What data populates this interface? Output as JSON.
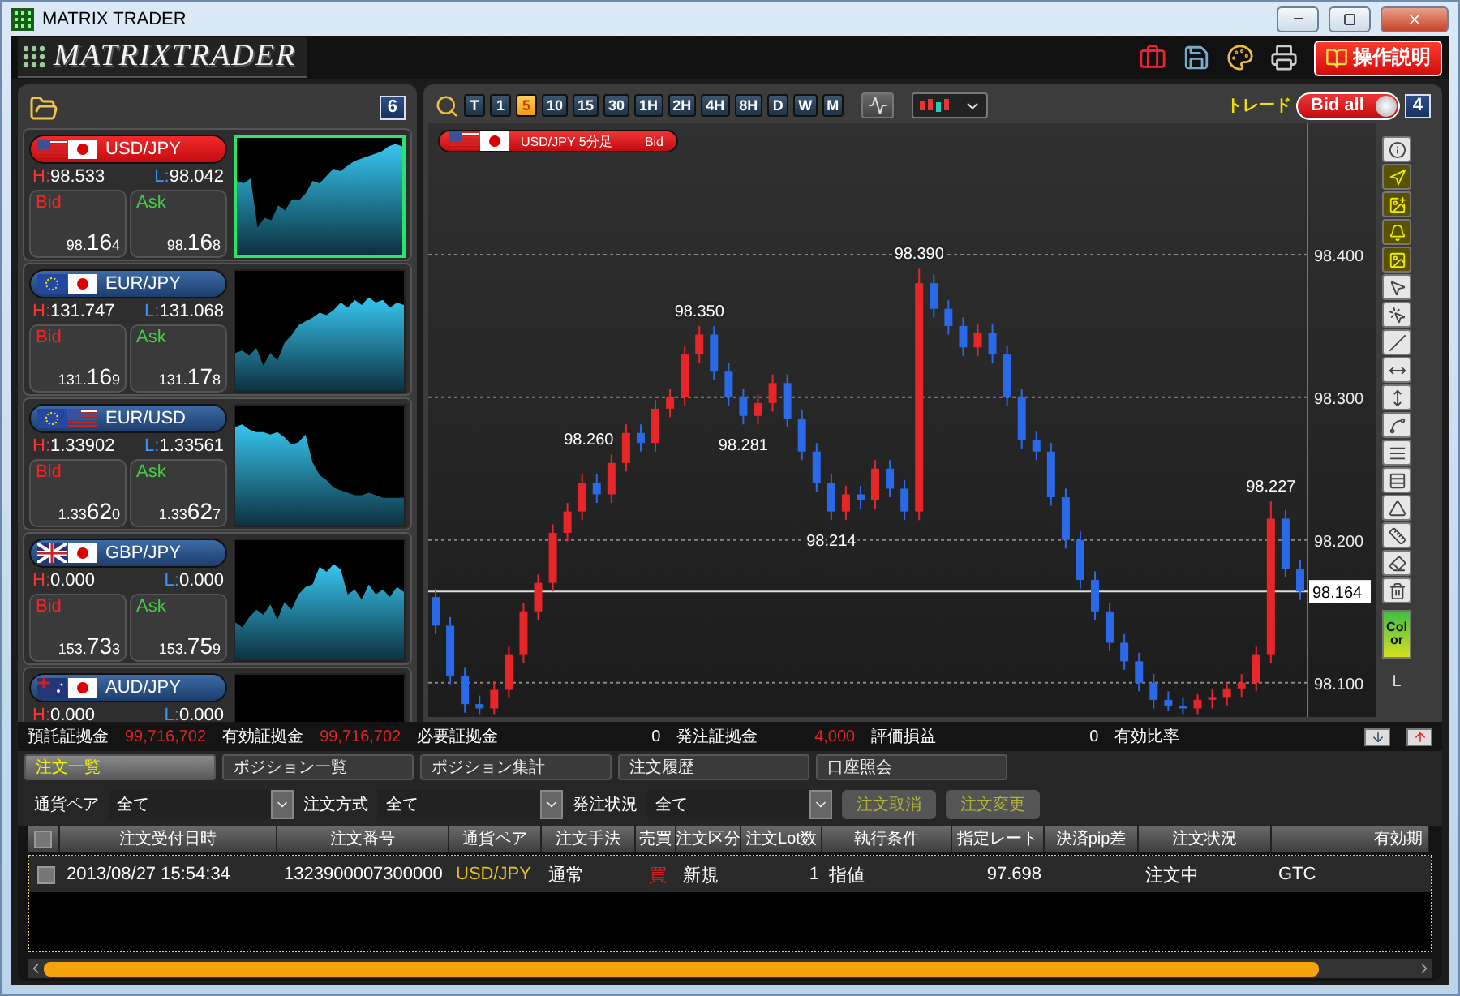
{
  "window": {
    "title": "MATRIX TRADER"
  },
  "app_bar": {
    "logo": "MATRIXTRADER",
    "help_button": "操作説明"
  },
  "watchlist": {
    "count": "6",
    "pairs": [
      {
        "name": "USD/JPY",
        "selected": true,
        "high_label": "H:",
        "high": "98.533",
        "low_label": "L:",
        "low": "98.042",
        "bid_label": "Bid",
        "bid": [
          "98.",
          "16",
          "4"
        ],
        "ask_label": "Ask",
        "ask": [
          "98.",
          "16",
          "8"
        ]
      },
      {
        "name": "EUR/JPY",
        "selected": false,
        "high_label": "H:",
        "high": "131.747",
        "low_label": "L:",
        "low": "131.068",
        "bid_label": "Bid",
        "bid": [
          "131.",
          "16",
          "9"
        ],
        "ask_label": "Ask",
        "ask": [
          "131.",
          "17",
          "8"
        ]
      },
      {
        "name": "EUR/USD",
        "selected": false,
        "high_label": "H:",
        "high": "1.33902",
        "low_label": "L:",
        "low": "1.33561",
        "bid_label": "Bid",
        "bid": [
          "1.33",
          "62",
          "0"
        ],
        "ask_label": "Ask",
        "ask": [
          "1.33",
          "62",
          "7"
        ]
      },
      {
        "name": "GBP/JPY",
        "selected": false,
        "high_label": "H:",
        "high": "0.000",
        "low_label": "L:",
        "low": "0.000",
        "bid_label": "Bid",
        "bid": [
          "153.",
          "73",
          "3"
        ],
        "ask_label": "Ask",
        "ask": [
          "153.",
          "75",
          "9"
        ]
      },
      {
        "name": "AUD/JPY",
        "selected": false,
        "high_label": "H:",
        "high": "0.000",
        "low_label": "L:",
        "low": "0.000"
      }
    ]
  },
  "chart": {
    "timeframes": [
      {
        "label": "T",
        "selected": false
      },
      {
        "label": "1",
        "selected": false
      },
      {
        "label": "5",
        "selected": true
      },
      {
        "label": "10",
        "selected": false
      },
      {
        "label": "15",
        "selected": false
      },
      {
        "label": "30",
        "selected": false
      },
      {
        "label": "1H",
        "selected": false
      },
      {
        "label": "2H",
        "selected": false
      },
      {
        "label": "4H",
        "selected": false
      },
      {
        "label": "8H",
        "selected": false
      },
      {
        "label": "D",
        "selected": false
      },
      {
        "label": "W",
        "selected": false
      },
      {
        "label": "M",
        "selected": false
      }
    ],
    "trade_label": "トレード",
    "bid_toggle": {
      "label": "Bid all",
      "on": true
    },
    "window_count": "4",
    "title": {
      "pair": "USD/JPY 5分足",
      "side": "Bid"
    },
    "chart_data": {
      "type": "candlestick",
      "grid": true,
      "ohlc": [
        [
          98.16,
          98.166,
          98.134,
          98.14
        ],
        [
          98.14,
          98.146,
          98.099,
          98.105
        ],
        [
          98.105,
          98.111,
          98.079,
          98.085
        ],
        [
          98.085,
          98.091,
          98.078,
          98.082
        ],
        [
          98.082,
          98.101,
          98.078,
          98.095
        ],
        [
          98.095,
          98.126,
          98.089,
          98.12
        ],
        [
          98.12,
          98.156,
          98.114,
          98.15
        ],
        [
          98.15,
          98.176,
          98.144,
          98.17
        ],
        [
          98.17,
          98.211,
          98.164,
          98.205
        ],
        [
          98.205,
          98.226,
          98.199,
          98.22
        ],
        [
          98.22,
          98.246,
          98.214,
          98.24
        ],
        [
          98.24,
          98.246,
          98.226,
          98.232
        ],
        [
          98.232,
          98.26,
          98.226,
          98.254
        ],
        [
          98.254,
          98.281,
          98.248,
          98.275
        ],
        [
          98.275,
          98.281,
          98.262,
          98.268
        ],
        [
          98.268,
          98.298,
          98.262,
          98.292
        ],
        [
          98.292,
          98.306,
          98.286,
          98.3
        ],
        [
          98.3,
          98.336,
          98.294,
          98.33
        ],
        [
          98.33,
          98.35,
          98.324,
          98.344
        ],
        [
          98.344,
          98.35,
          98.312,
          98.318
        ],
        [
          98.318,
          98.324,
          98.294,
          98.3
        ],
        [
          98.3,
          98.306,
          98.281,
          98.287
        ],
        [
          98.287,
          98.302,
          98.281,
          98.296
        ],
        [
          98.296,
          98.316,
          98.29,
          98.31
        ],
        [
          98.31,
          98.316,
          98.279,
          98.285
        ],
        [
          98.285,
          98.291,
          98.256,
          98.262
        ],
        [
          98.262,
          98.268,
          98.234,
          98.24
        ],
        [
          98.24,
          98.246,
          98.214,
          98.22
        ],
        [
          98.22,
          98.238,
          98.214,
          98.232
        ],
        [
          98.232,
          98.238,
          98.222,
          98.228
        ],
        [
          98.228,
          98.256,
          98.222,
          98.25
        ],
        [
          98.25,
          98.256,
          98.23,
          98.236
        ],
        [
          98.236,
          98.242,
          98.214,
          98.22
        ],
        [
          98.22,
          98.39,
          98.214,
          98.38
        ],
        [
          98.38,
          98.386,
          98.356,
          98.362
        ],
        [
          98.362,
          98.368,
          98.344,
          98.35
        ],
        [
          98.35,
          98.356,
          98.329,
          98.335
        ],
        [
          98.335,
          98.351,
          98.329,
          98.345
        ],
        [
          98.345,
          98.351,
          98.324,
          98.33
        ],
        [
          98.33,
          98.336,
          98.294,
          98.3
        ],
        [
          98.3,
          98.306,
          98.264,
          98.27
        ],
        [
          98.27,
          98.276,
          98.256,
          98.262
        ],
        [
          98.262,
          98.268,
          98.224,
          98.23
        ],
        [
          98.23,
          98.236,
          98.194,
          98.2
        ],
        [
          98.2,
          98.206,
          98.166,
          98.172
        ],
        [
          98.172,
          98.178,
          98.144,
          98.15
        ],
        [
          98.15,
          98.156,
          98.122,
          98.128
        ],
        [
          98.128,
          98.134,
          98.109,
          98.115
        ],
        [
          98.115,
          98.121,
          98.094,
          98.1
        ],
        [
          98.1,
          98.106,
          98.082,
          98.088
        ],
        [
          98.088,
          98.094,
          98.08,
          98.084
        ],
        [
          98.084,
          98.09,
          98.078,
          98.082
        ],
        [
          98.082,
          98.092,
          98.078,
          98.088
        ],
        [
          98.088,
          98.096,
          98.082,
          98.09
        ],
        [
          98.09,
          98.1,
          98.084,
          98.096
        ],
        [
          98.096,
          98.106,
          98.09,
          98.1
        ],
        [
          98.1,
          98.126,
          98.094,
          98.12
        ],
        [
          98.12,
          98.227,
          98.114,
          98.215
        ],
        [
          98.215,
          98.221,
          98.174,
          98.18
        ],
        [
          98.18,
          98.186,
          98.158,
          98.164
        ]
      ],
      "ylim": [
        98.076,
        98.492
      ],
      "yticks": [
        {
          "value": 98.4,
          "label": "98.400"
        },
        {
          "value": 98.3,
          "label": "98.300"
        },
        {
          "value": 98.2,
          "label": "98.200"
        },
        {
          "value": 98.1,
          "label": "98.100"
        }
      ],
      "annotations": [
        "98.390",
        "98.350",
        "98.260",
        "98.281",
        "98.214",
        "98.227"
      ],
      "ref_lines": [
        {
          "axis": "y",
          "value": 98.164,
          "label": "98.164"
        }
      ]
    },
    "color_button": "Color",
    "lot_label": "L"
  },
  "account": [
    {
      "label": "預託証拠金",
      "value": "99,716,702",
      "color": "#e02424"
    },
    {
      "label": "有効証拠金",
      "value": "99,716,702",
      "color": "#e02424"
    },
    {
      "label": "必要証拠金",
      "value": "0",
      "color": "#ffffff"
    },
    {
      "label": "発注証拠金",
      "value": "4,000",
      "color": "#e02424"
    },
    {
      "label": "評価損益",
      "value": "0",
      "color": "#ffffff"
    },
    {
      "label": "有効比率"
    }
  ],
  "tabs": [
    {
      "label": "注文一覧",
      "selected": true
    },
    {
      "label": "ポジション一覧",
      "selected": false
    },
    {
      "label": "ポジション集計",
      "selected": false
    },
    {
      "label": "注文履歴",
      "selected": false
    },
    {
      "label": "口座照会",
      "selected": false
    }
  ],
  "filters": [
    {
      "label": "通貨ペア",
      "value": "全て"
    },
    {
      "label": "注文方式",
      "value": "全て"
    },
    {
      "label": "発注状況",
      "value": "全て"
    }
  ],
  "actions": [
    {
      "label": "注文取消",
      "disabled": true
    },
    {
      "label": "注文変更",
      "disabled": true
    }
  ],
  "table": {
    "columns": [
      "注文受付日時",
      "注文番号",
      "通貨ペア",
      "注文手法",
      "売買",
      "注文区分",
      "注文Lot数",
      "執行条件",
      "指定レート",
      "決済pip差",
      "注文状況",
      "有効期"
    ],
    "rows": [
      {
        "checked": false,
        "cells": [
          {
            "text": "2013/08/27  15:54:34"
          },
          {
            "text": "1323900007300000"
          },
          {
            "text": "USD/JPY",
            "color": "#e8c020"
          },
          {
            "text": "通常"
          },
          {
            "text": "買",
            "color": "#e02020"
          },
          {
            "text": "新規"
          },
          {
            "text": "1"
          },
          {
            "text": "指値"
          },
          {
            "text": "97.698"
          },
          {},
          {
            "text": "注文中"
          },
          {
            "text": "GTC"
          }
        ]
      }
    ]
  }
}
